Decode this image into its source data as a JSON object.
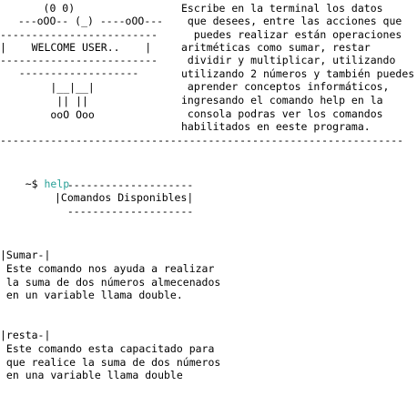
{
  "banner": {
    "ascii_lines": [
      "      (0 0)",
      "  ---oOO-- (_) ----oOO---",
      "-------------------------",
      "|    WELCOME USER..    |",
      "-------------------------",
      "   -------------------",
      "        |__|__|",
      "         || ||",
      "        ooO Ooo"
    ],
    "text_lines": [
      "Escribe en la terminal los datos",
      " que desees, entre las acciones que",
      "  puedes realizar están operaciones",
      "aritméticas como sumar, restar",
      " dividir y multiplicar, utilizando",
      "utilizando 2 números y también puedes",
      " aprender conceptos informáticos,",
      "ingresando el comando help en la",
      " consola podras ver los comandos",
      "habilitados en eeste programa."
    ],
    "separator": "----------------------------------------------------------------"
  },
  "prompt": {
    "symbol": "~$",
    "command": "help"
  },
  "help_box": {
    "top": "  --------------------",
    "title": "|Comandos Disponibles|",
    "bottom": "  --------------------"
  },
  "commands": [
    {
      "name": "|Sumar-|",
      "description": [
        " Este comando nos ayuda a realizar",
        " la suma de dos números almecenados",
        " en un variable llama double."
      ]
    },
    {
      "name": "|resta-|",
      "description": [
        " Este comando esta capacitado para",
        " que realice la suma de dos números",
        " en una variable llama double"
      ]
    }
  ]
}
